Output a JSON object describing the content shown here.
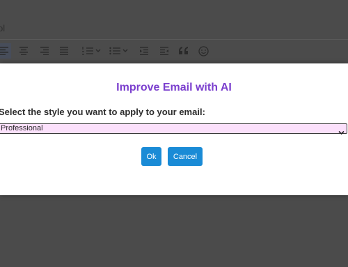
{
  "editor": {
    "title_fragment": "ol",
    "toolbar": [
      {
        "icon": "align-left-icon"
      },
      {
        "icon": "align-center-icon"
      },
      {
        "icon": "align-right-icon"
      },
      {
        "icon": "align-justify-icon"
      },
      {
        "icon": "numbered-list-icon"
      },
      {
        "icon": "bullet-list-icon"
      },
      {
        "icon": "indent-icon"
      },
      {
        "icon": "outdent-icon"
      },
      {
        "icon": "blockquote-icon"
      },
      {
        "icon": "emoji-icon"
      }
    ]
  },
  "dialog": {
    "title": "Improve Email with AI",
    "prompt": "Select the style you want to apply to your email:",
    "select": {
      "selected": "Professional"
    },
    "buttons": {
      "ok": "Ok",
      "cancel": "Cancel"
    },
    "colors": {
      "title": "#7b3fce",
      "button": "#1a8bd6",
      "select_bg": "#fbe0fb"
    }
  }
}
